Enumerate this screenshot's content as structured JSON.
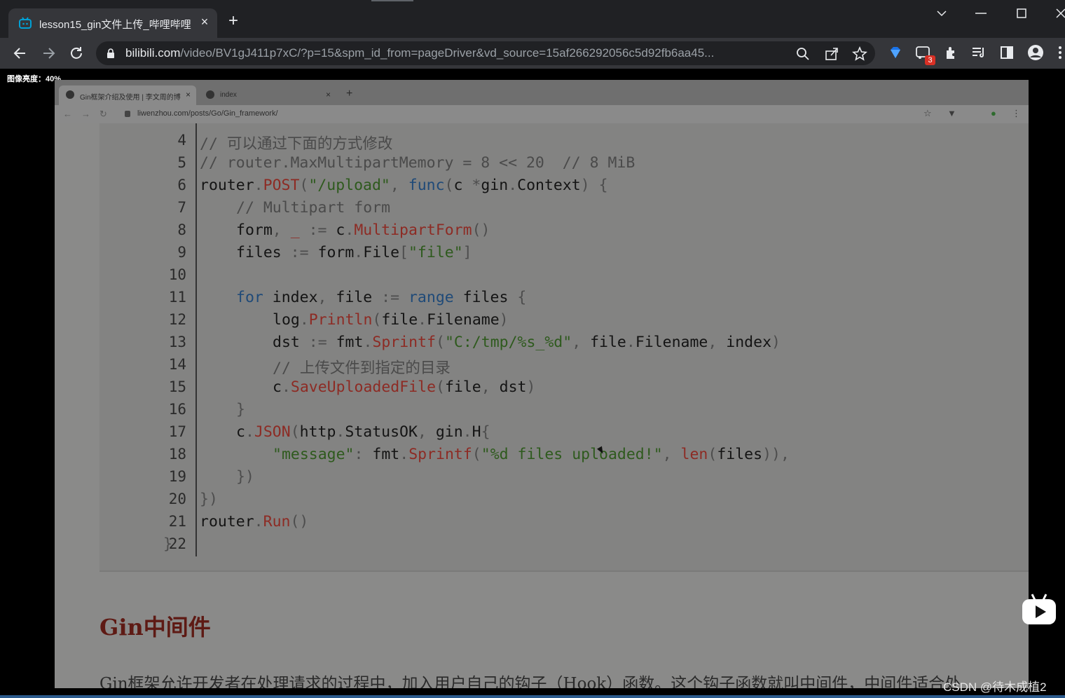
{
  "browser": {
    "tab_title": "lesson15_gin文件上传_哔哩哔哩",
    "tab_close": "×",
    "new_tab": "+",
    "url_host": "bilibili.com",
    "url_path": "/video/BV1gJ411p7xC/?p=15&spm_id_from=pageDriver&vd_source=15af266292056c5d92fb6aa45...",
    "ext_badge": "3"
  },
  "overlay": {
    "brightness_label": "图像亮度：40%"
  },
  "inner_browser": {
    "tab1_title": "Gin框架介绍及使用 | 李文周的博",
    "tab1_close": "×",
    "tab2_title": "index",
    "tab2_close": "×",
    "new_tab": "+",
    "url": "liwenzhou.com/posts/Go/Gin_framework/"
  },
  "code": {
    "line_numbers": [
      "4",
      "5",
      "6",
      "7",
      "8",
      "9",
      "10",
      "11",
      "12",
      "13",
      "14",
      "15",
      "16",
      "17",
      "18",
      "19",
      "20",
      "21",
      "22"
    ]
  },
  "article": {
    "heading": "Gin中间件",
    "paragraph": "Gin框架允许开发者在处理请求的过程中，加入用户自己的钩子（Hook）函数。这个钩子函数就叫中间件，中间件适合处"
  },
  "footer": {
    "watermark": "CSDN @待木成植2"
  },
  "colors": {
    "chrome_bg": "#202124",
    "chrome_toolbar": "#35363a",
    "heading": "#5e1a14"
  }
}
